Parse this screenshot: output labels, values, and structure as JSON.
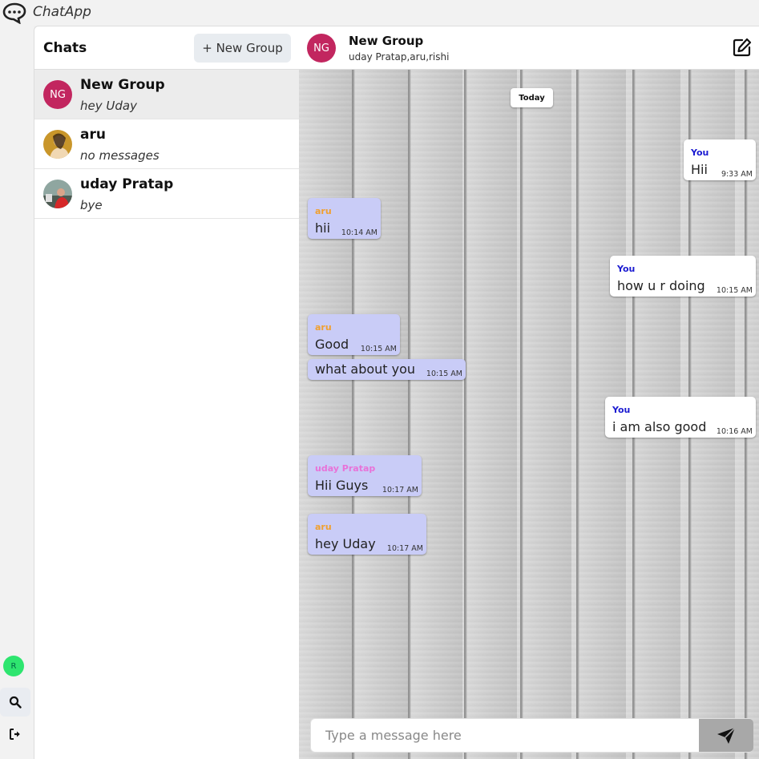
{
  "app": {
    "title": "ChatApp"
  },
  "rail": {
    "user_initial": "R"
  },
  "chat_list": {
    "title": "Chats",
    "new_group_label": "+ New Group",
    "items": [
      {
        "name": "New Group",
        "last_message": "hey Uday",
        "avatar_text": "NG",
        "avatar_color": "#c2265f",
        "active": true
      },
      {
        "name": "aru",
        "last_message": "no messages",
        "avatar_text": "",
        "avatar_color": "#c9962a",
        "active": false
      },
      {
        "name": "uday Pratap",
        "last_message": "bye",
        "avatar_text": "",
        "avatar_color": "#6a7f6e",
        "active": false
      }
    ]
  },
  "conversation": {
    "name": "New Group",
    "avatar_text": "NG",
    "members": "uday Pratap,aru,rishi",
    "date_label": "Today",
    "messages": [
      {
        "sender": "You",
        "text": "Hii",
        "time": "9:33 AM",
        "mine": true
      },
      {
        "sender": "aru",
        "text": "hii",
        "time": "10:14 AM",
        "mine": false
      },
      {
        "sender": "You",
        "text": "how u r doing",
        "time": "10:15 AM",
        "mine": true
      },
      {
        "sender": "aru",
        "text": "Good",
        "time": "10:15 AM",
        "mine": false
      },
      {
        "sender": "",
        "text": "what about you",
        "time": "10:15 AM",
        "mine": false
      },
      {
        "sender": "You",
        "text": "i am also good",
        "time": "10:16 AM",
        "mine": true
      },
      {
        "sender": "uday Pratap",
        "text": "Hii Guys",
        "time": "10:17 AM",
        "mine": false
      },
      {
        "sender": "aru",
        "text": "hey Uday",
        "time": "10:17 AM",
        "mine": false
      }
    ]
  },
  "composer": {
    "placeholder": "Type a message here"
  },
  "colors": {
    "sender_you": "#1b1bd1",
    "sender_aru": "#f0a030",
    "sender_uday": "#e872d8",
    "bubble_theirs": "#c9ccf7",
    "accent": "#c2265f"
  }
}
